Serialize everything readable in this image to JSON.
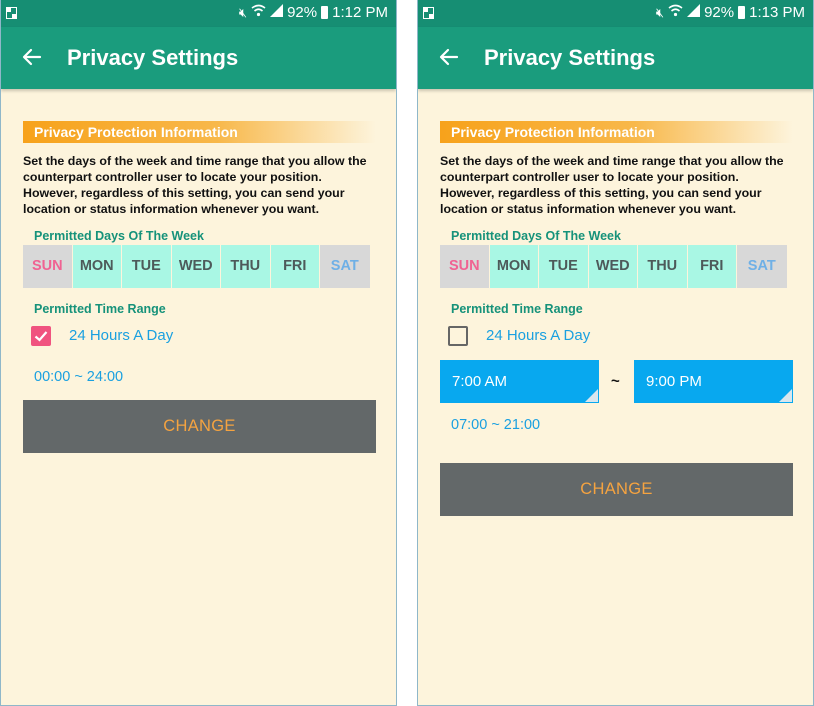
{
  "screens": [
    {
      "status": {
        "battery": "92%",
        "time": "1:12 PM"
      },
      "title": "Privacy Settings",
      "info_header": "Privacy Protection Information",
      "description": "Set the days of the week and time range that you allow the counterpart controller user to locate your position. However, regardless of this setting, you can send your location or status information whenever you want.",
      "days_label": "Permitted Days Of The Week",
      "days": [
        "SUN",
        "MON",
        "TUE",
        "WED",
        "THU",
        "FRI",
        "SAT"
      ],
      "time_label": "Permitted Time Range",
      "all_day_label": "24 Hours A Day",
      "all_day_checked": true,
      "range_text": "00:00 ~ 24:00",
      "change_label": "CHANGE"
    },
    {
      "status": {
        "battery": "92%",
        "time": "1:13 PM"
      },
      "title": "Privacy Settings",
      "info_header": "Privacy Protection Information",
      "description": "Set the days of the week and time range that you allow the counterpart controller user to locate your position. However, regardless of this setting, you can send your location or status information whenever you want.",
      "days_label": "Permitted Days Of The Week",
      "days": [
        "SUN",
        "MON",
        "TUE",
        "WED",
        "THU",
        "FRI",
        "SAT"
      ],
      "time_label": "Permitted Time Range",
      "all_day_label": "24 Hours A Day",
      "all_day_checked": false,
      "start_time": "7:00 AM",
      "separator": "~",
      "end_time": "9:00 PM",
      "range_text": "07:00 ~ 21:00",
      "change_label": "CHANGE"
    }
  ],
  "colors": {
    "status_bar": "#168e73",
    "app_bar": "#1a9c7d",
    "background": "#fdf4dc",
    "day_selected": "#a9f7e4",
    "day_unselected": "#d8d8d8",
    "checkbox_checked": "#f0537f",
    "accent_text": "#1aa0e0",
    "time_picker": "#08a8ef",
    "button": "#636869",
    "button_text": "#f5a340"
  },
  "icons": {
    "back": "arrow-left-icon",
    "mute": "mute-icon",
    "wifi": "wifi-icon",
    "signal": "signal-icon",
    "battery": "battery-icon",
    "check": "check-icon"
  }
}
